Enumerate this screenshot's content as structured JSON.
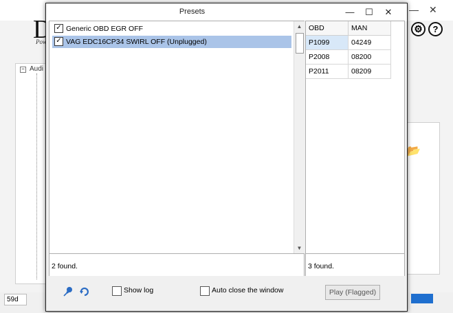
{
  "background_app": {
    "logo_letter": "D",
    "logo_subtitle": "Pow",
    "tree_label": "Audi",
    "tree_toggle": "−",
    "status_value": "59d",
    "controls": {
      "minimize": "—",
      "close": "✕"
    },
    "help_icon_text": "?",
    "folder_glyph": "📂",
    "gear_glyph": "⚙"
  },
  "dialog": {
    "title": "Presets",
    "controls": {
      "minimize": "—",
      "maximize": "☐",
      "close": "✕"
    },
    "presets": [
      {
        "label": "Generic OBD EGR OFF",
        "checked": true,
        "selected": false
      },
      {
        "label": "VAG EDC16CP34 SWIRL OFF (Unplugged)",
        "checked": true,
        "selected": true
      }
    ],
    "presets_count": "2 found.",
    "codes_table": {
      "columns": [
        "OBD",
        "MAN"
      ],
      "rows": [
        [
          "P1099",
          "04249"
        ],
        [
          "P2008",
          "08200"
        ],
        [
          "P2011",
          "08209"
        ]
      ]
    },
    "codes_count": "3 found.",
    "show_log": {
      "label": "Show log",
      "checked": false
    },
    "auto_close": {
      "label": "Auto close the window",
      "checked": false
    },
    "play_button": "Play (Flagged)",
    "check_mark": "✓",
    "scroll_up": "▲",
    "scroll_down": "▼",
    "colors": {
      "selection": "#aac4e8",
      "accent_blue": "#1f6fcf"
    }
  }
}
